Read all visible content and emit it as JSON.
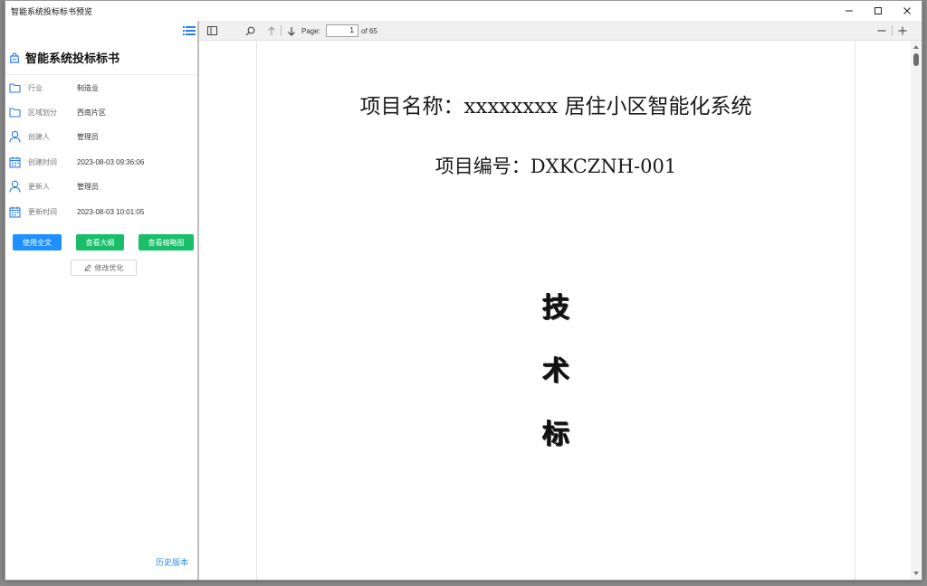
{
  "window": {
    "title": "智能系统投标标书预览"
  },
  "sidebar": {
    "doc_title": "智能系统投标标书",
    "meta": [
      {
        "label": "行业",
        "value": "制造业"
      },
      {
        "label": "区域划分",
        "value": "西南片区"
      },
      {
        "label": "创建人",
        "value": "管理员"
      },
      {
        "label": "创建时间",
        "value": "2023-08-03 09:36:06"
      },
      {
        "label": "更新人",
        "value": "管理员"
      },
      {
        "label": "更新时间",
        "value": "2023-08-03 10:01:05"
      }
    ],
    "buttons": {
      "use_full": "使用全文",
      "view_outline": "查看大纲",
      "view_thumbnail": "查看缩略图",
      "modify_optimize": "修改优化"
    },
    "history_link": "历史版本"
  },
  "pdf_toolbar": {
    "page_label": "Page:",
    "current_page": "1",
    "total_pages": "of 65"
  },
  "pdf_page": {
    "line1": "项目名称：xxxxxxxx 居住小区智能化系统",
    "line2": "项目编号：DXKCZNH-001",
    "chars": [
      "技",
      "术",
      "标"
    ]
  },
  "colors": {
    "primary_blue": "#1e90ff",
    "primary_green": "#19be6b",
    "link_blue": "#2d8cf0",
    "icon_blue": "#2b7de9"
  }
}
